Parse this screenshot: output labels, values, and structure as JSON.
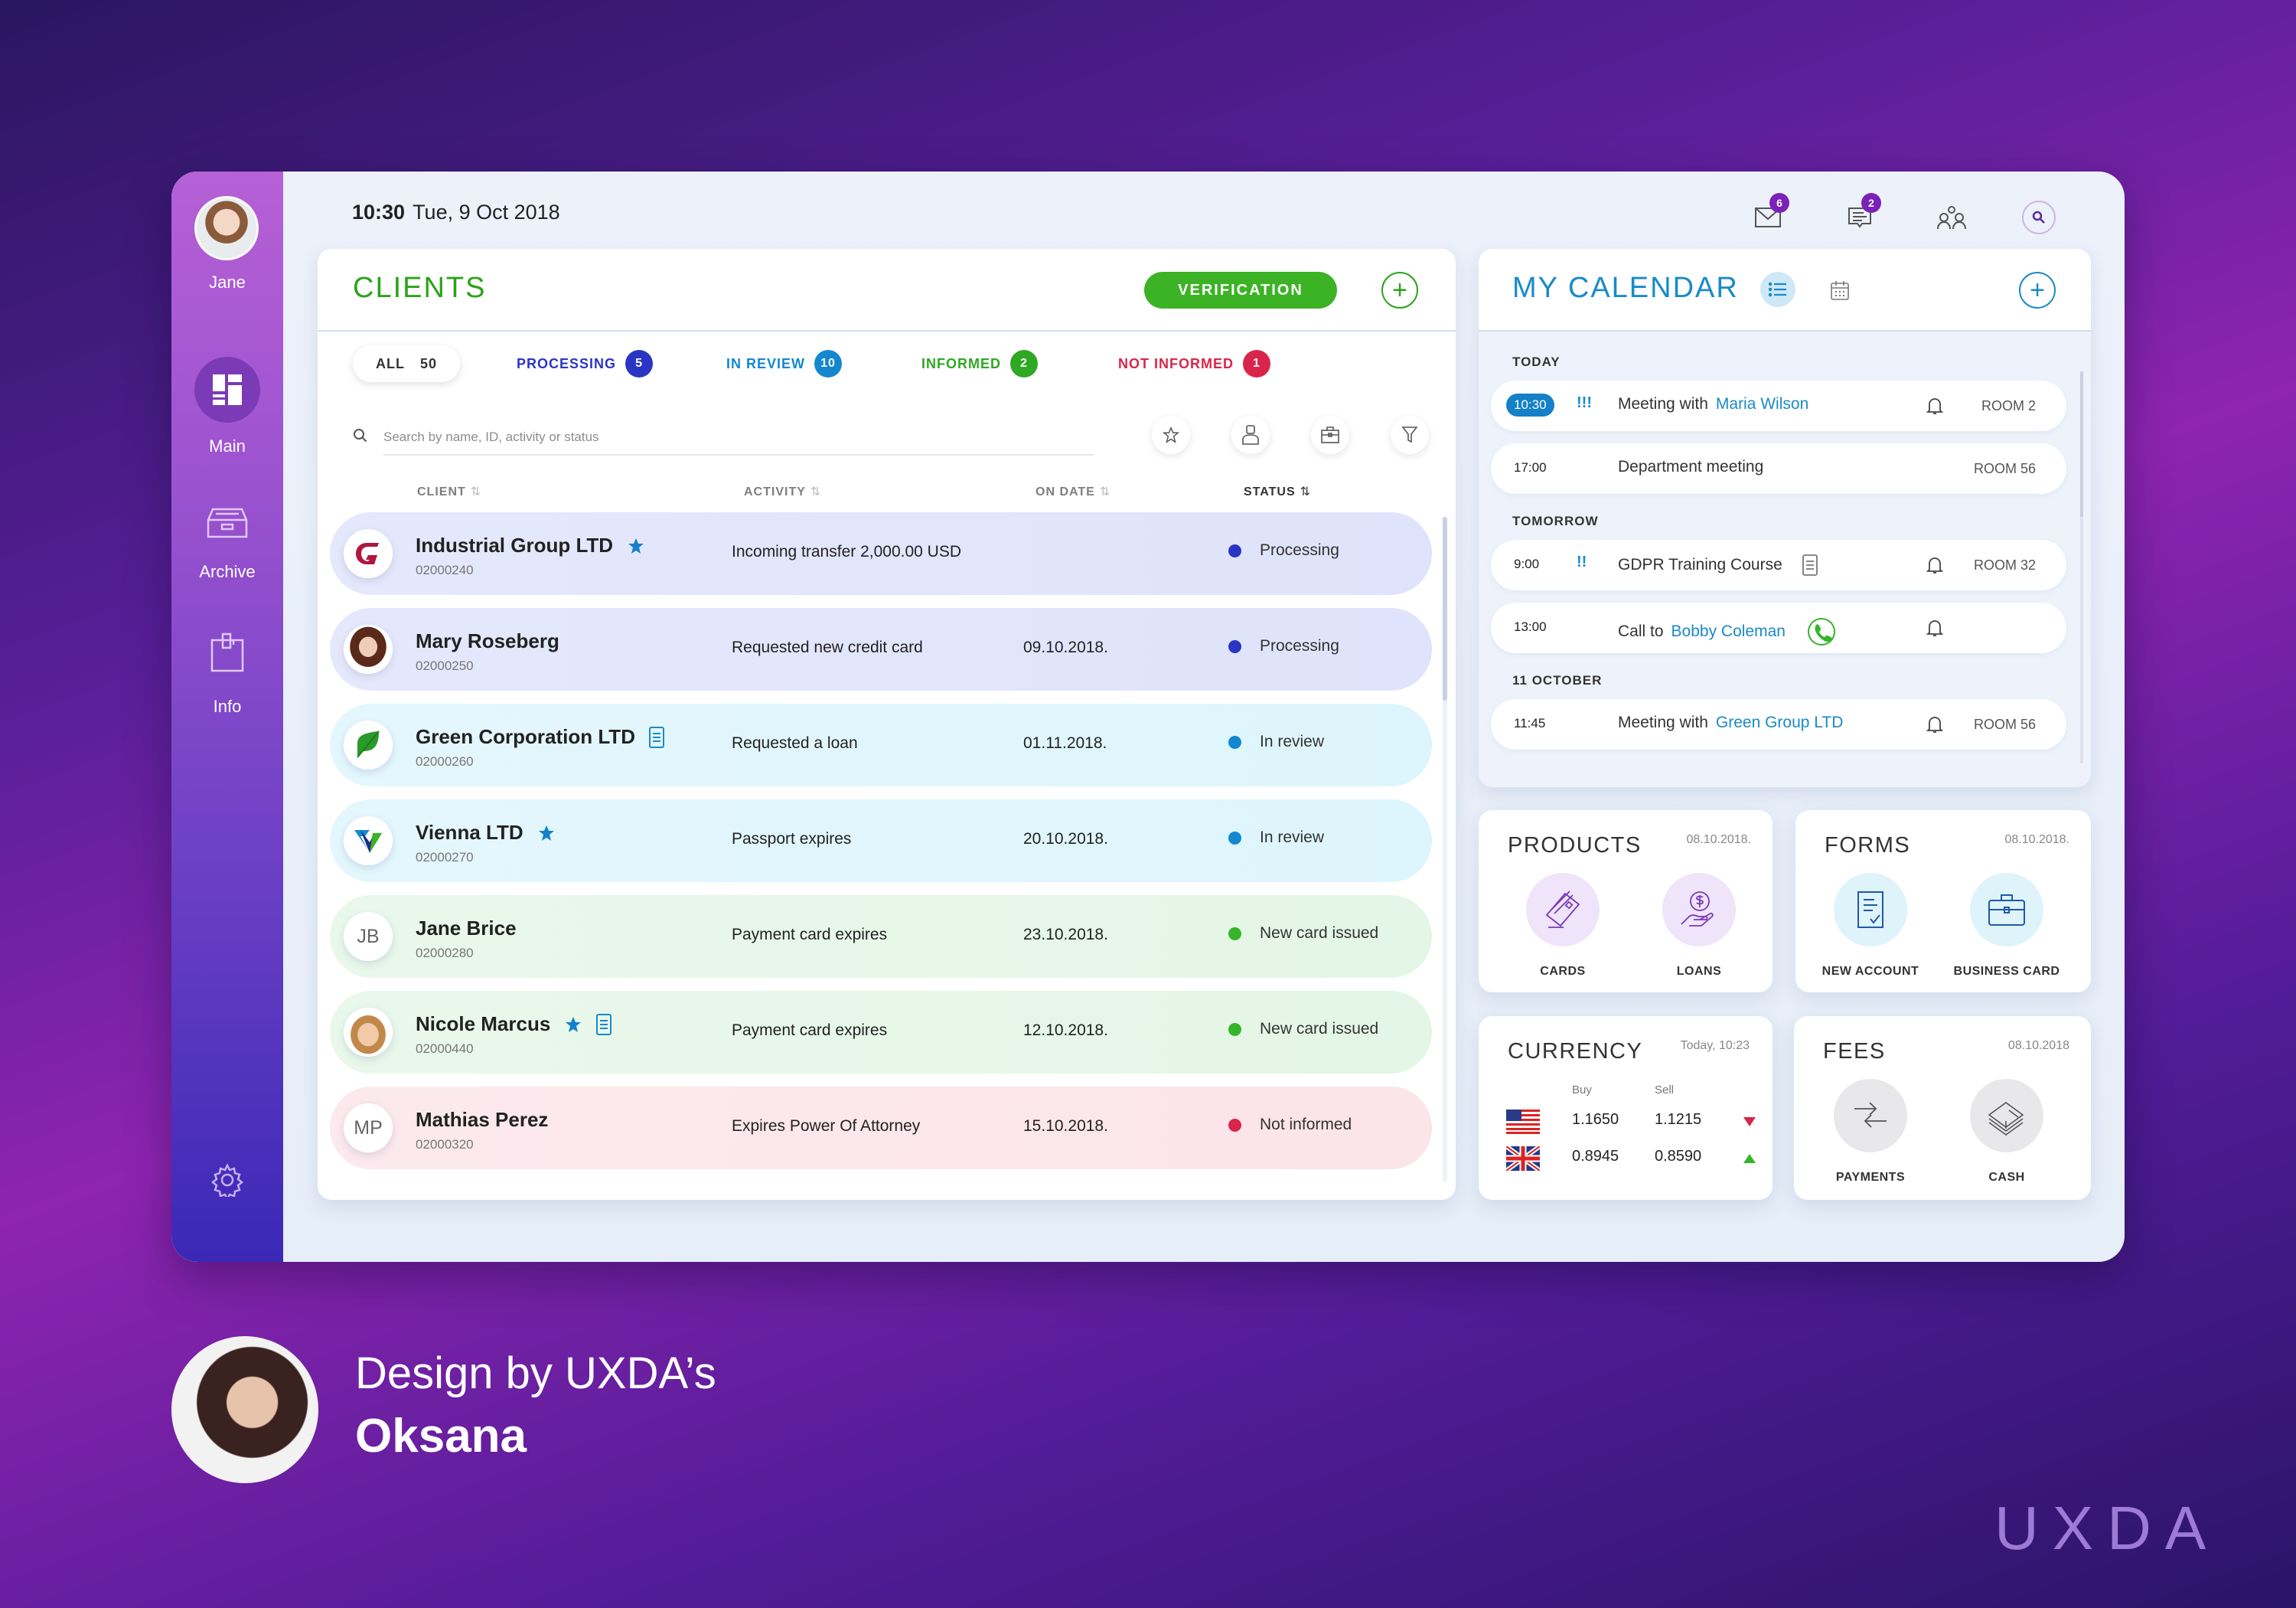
{
  "user": {
    "name": "Jane"
  },
  "sidebar": {
    "items": [
      {
        "label": "Main",
        "icon": "dashboard-icon",
        "active": true
      },
      {
        "label": "Archive",
        "icon": "archive-icon"
      },
      {
        "label": "Info",
        "icon": "clipboard-icon"
      }
    ],
    "settings_icon": "gear-icon"
  },
  "topbar": {
    "time": "10:30",
    "date": "Tue, 9 Oct 2018",
    "mail_count": "6",
    "messages_count": "2"
  },
  "clients": {
    "title": "CLIENTS",
    "verification_label": "VERIFICATION",
    "filters": [
      {
        "label": "ALL",
        "count": "50",
        "color": "#333333"
      },
      {
        "label": "PROCESSING",
        "count": "5",
        "color": "#2a35c4"
      },
      {
        "label": "IN REVIEW",
        "count": "10",
        "color": "#1487cf"
      },
      {
        "label": "INFORMED",
        "count": "2",
        "color": "#2fa823"
      },
      {
        "label": "NOT INFORMED",
        "count": "1",
        "color": "#d9254b"
      }
    ],
    "search_placeholder": "Search by name, ID, activity or status",
    "columns": {
      "client": "CLIENT",
      "activity": "ACTIVITY",
      "on_date": "ON DATE",
      "status": "STATUS",
      "sort_arrows": "⇅"
    },
    "rows": [
      {
        "name": "Industrial Group LTD",
        "id": "02000240",
        "activity": "Incoming transfer 2,000.00 USD",
        "date": "",
        "status": "Processing",
        "starred": true,
        "has_doc": false,
        "avatar": "G",
        "avatar_type": "logo-g"
      },
      {
        "name": "Mary Roseberg",
        "id": "02000250",
        "activity": "Requested new credit card",
        "date": "09.10.2018.",
        "status": "Processing",
        "starred": false,
        "has_doc": false,
        "avatar": "",
        "avatar_type": "photo-woman"
      },
      {
        "name": "Green Corporation LTD",
        "id": "02000260",
        "activity": "Requested a loan",
        "date": "01.11.2018.",
        "status": "In review",
        "starred": false,
        "has_doc": true,
        "avatar": "",
        "avatar_type": "logo-leaf"
      },
      {
        "name": "Vienna LTD",
        "id": "02000270",
        "activity": "Passport expires",
        "date": "20.10.2018.",
        "status": "In review",
        "starred": true,
        "has_doc": false,
        "avatar": "",
        "avatar_type": "logo-v"
      },
      {
        "name": "Jane Brice",
        "id": "02000280",
        "activity": "Payment card expires",
        "date": "23.10.2018.",
        "status": "New card issued",
        "starred": false,
        "has_doc": false,
        "avatar": "JB",
        "avatar_type": "initials"
      },
      {
        "name": "Nicole Marcus",
        "id": "02000440",
        "activity": "Payment card expires",
        "date": "12.10.2018.",
        "status": "New card issued",
        "starred": true,
        "has_doc": true,
        "avatar": "",
        "avatar_type": "photo-man"
      },
      {
        "name": "Mathias Perez",
        "id": "02000320",
        "activity": "Expires Power Of Attorney",
        "date": "15.10.2018.",
        "status": "Not informed",
        "starred": false,
        "has_doc": false,
        "avatar": "MP",
        "avatar_type": "initials"
      }
    ]
  },
  "status_colors": {
    "Processing": {
      "dot": "#2a35c4",
      "bg": "#dfe3fb"
    },
    "In review": {
      "dot": "#1487cf",
      "bg": "#ddf5fc"
    },
    "New card issued": {
      "dot": "#36b52a",
      "bg": "#e4f6e6"
    },
    "Not informed": {
      "dot": "#d9254b",
      "bg": "#fbe4ea"
    }
  },
  "calendar": {
    "title": "MY CALENDAR",
    "sections": [
      {
        "label": "TODAY",
        "events": [
          {
            "time": "10:30",
            "now": true,
            "priority": "!!!",
            "prefix": "Meeting with",
            "link": "Maria Wilson",
            "bell": true,
            "room": "ROOM 2"
          },
          {
            "time": "17:00",
            "now": false,
            "priority": "",
            "prefix": "Department meeting",
            "link": "",
            "bell": false,
            "room": "ROOM 56"
          }
        ]
      },
      {
        "label": "TOMORROW",
        "events": [
          {
            "time": "9:00",
            "now": false,
            "priority": "!!",
            "prefix": "GDPR Training Course",
            "link": "",
            "doc": true,
            "bell": true,
            "room": "ROOM 32"
          },
          {
            "time": "13:00",
            "now": false,
            "priority": "",
            "prefix": "Call to",
            "link": "Bobby Coleman",
            "phone": true,
            "bell": true,
            "room": ""
          }
        ]
      },
      {
        "label": "11 OCTOBER",
        "events": [
          {
            "time": "11:45",
            "now": false,
            "priority": "",
            "prefix": "Meeting with",
            "link": "Green Group LTD",
            "bell": true,
            "room": "ROOM 56"
          }
        ]
      }
    ]
  },
  "products": {
    "title": "PRODUCTS",
    "date": "08.10.2018.",
    "items": [
      {
        "label": "CARDS",
        "icon": "credit-card-icon"
      },
      {
        "label": "LOANS",
        "icon": "money-hand-icon"
      }
    ]
  },
  "forms": {
    "title": "FORMS",
    "date": "08.10.2018.",
    "items": [
      {
        "label": "NEW ACCOUNT",
        "icon": "document-check-icon"
      },
      {
        "label": "BUSINESS CARD",
        "icon": "briefcase-icon"
      }
    ]
  },
  "currency": {
    "title": "CURRENCY",
    "date": "Today, 10:23",
    "buy_label": "Buy",
    "sell_label": "Sell",
    "rows": [
      {
        "flag": "us-flag-icon",
        "buy": "1.1650",
        "sell": "1.1215",
        "trend": "down",
        "trend_color": "#d9254b"
      },
      {
        "flag": "uk-flag-icon",
        "buy": "0.8945",
        "sell": "0.8590",
        "trend": "up",
        "trend_color": "#36b52a"
      }
    ]
  },
  "fees": {
    "title": "FEES",
    "date": "08.10.2018",
    "items": [
      {
        "label": "PAYMENTS",
        "icon": "exchange-arrows-icon"
      },
      {
        "label": "CASH",
        "icon": "cash-stack-icon"
      }
    ]
  },
  "attribution": {
    "line1": "Design by UXDA’s",
    "name": "Oksana",
    "brand": "UXDA"
  }
}
